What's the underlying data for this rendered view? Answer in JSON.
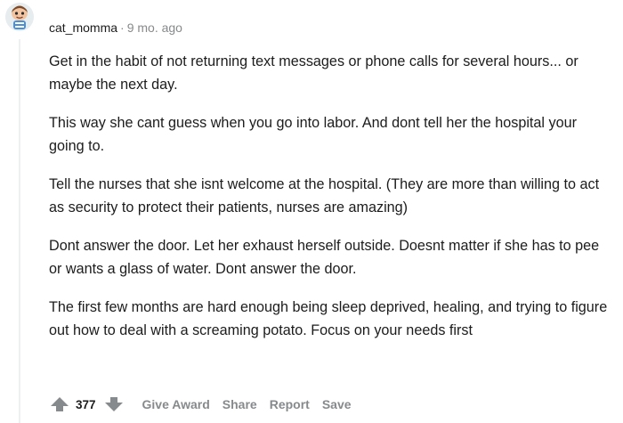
{
  "comment": {
    "username": "cat_momma",
    "separator": "·",
    "timestamp": "9 mo. ago",
    "paragraphs": [
      "Get in the habit of not returning text messages or phone calls for several hours... or maybe the next day.",
      "This way she cant guess when you go into labor. And dont tell her the hospital your going to.",
      "Tell the nurses that she isnt welcome at the hospital. (They are more than willing to act as security to protect their patients, nurses are amazing)",
      "Dont answer the door. Let her exhaust herself outside. Doesnt matter if she has to pee or wants a glass of water. Dont answer the door.",
      "The first few months are hard enough being sleep deprived, healing, and trying to figure out how to deal with a screaming potato. Focus on your needs first"
    ],
    "score": "377",
    "actions": {
      "give_award": "Give Award",
      "share": "Share",
      "report": "Report",
      "save": "Save"
    }
  },
  "icons": {
    "avatar": "snoo-avatar-icon",
    "upvote": "upvote-arrow-icon",
    "downvote": "downvote-arrow-icon"
  },
  "colors": {
    "text": "#1c1c1c",
    "meta": "#878a8c",
    "thread_line": "#edeff1",
    "background": "#ffffff"
  }
}
